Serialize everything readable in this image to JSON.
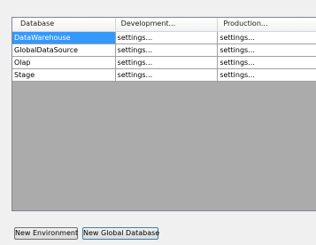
{
  "grid": {
    "headers": [
      "Database",
      "Development...",
      "Production..."
    ],
    "rows": [
      [
        "DataWarehouse",
        "settings...",
        "settings..."
      ],
      [
        "GlobalDataSource",
        "settings...",
        "settings..."
      ],
      [
        "Olap",
        "settings...",
        "settings..."
      ],
      [
        "Stage",
        "settings...",
        "settings..."
      ]
    ],
    "selected_row": 0,
    "selected_color": "#3399ff",
    "empty_area_color": "#ababab"
  },
  "buttons": {
    "new_environment": "New Environment",
    "new_global_database": "New Global Database"
  }
}
